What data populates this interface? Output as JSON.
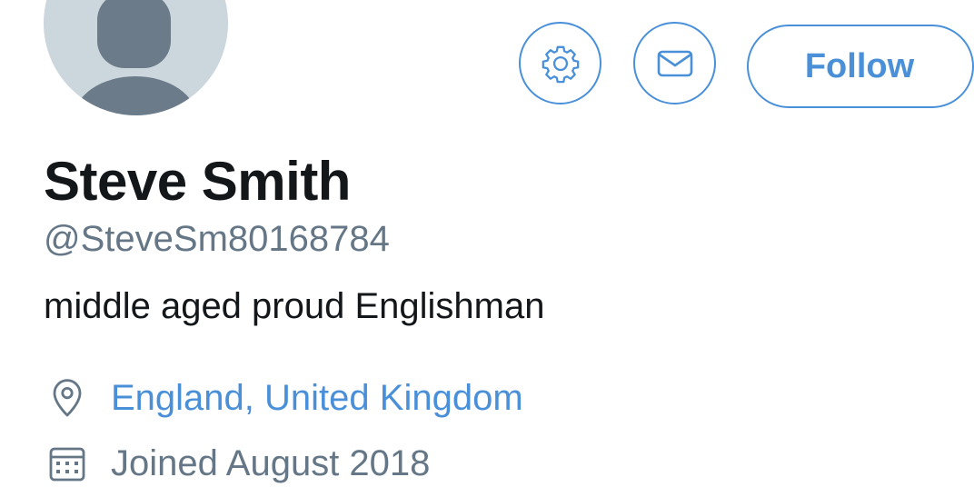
{
  "profile": {
    "avatar_icon": "default-avatar-icon",
    "name": "Steve Smith",
    "handle": "@SteveSm80168784",
    "bio": "middle aged proud Englishman",
    "location": "England, United Kingdom",
    "joined": "Joined August 2018"
  },
  "actions": {
    "settings_icon": "gear-icon",
    "message_icon": "envelope-icon",
    "follow_label": "Follow"
  },
  "meta_icons": {
    "location_icon": "location-pin-icon",
    "joined_icon": "calendar-icon"
  },
  "colors": {
    "accent": "#4a90d9",
    "text_primary": "#14171a",
    "text_secondary": "#657786",
    "avatar_background": "#ccd6dd",
    "avatar_figure": "#6b7b8a"
  }
}
